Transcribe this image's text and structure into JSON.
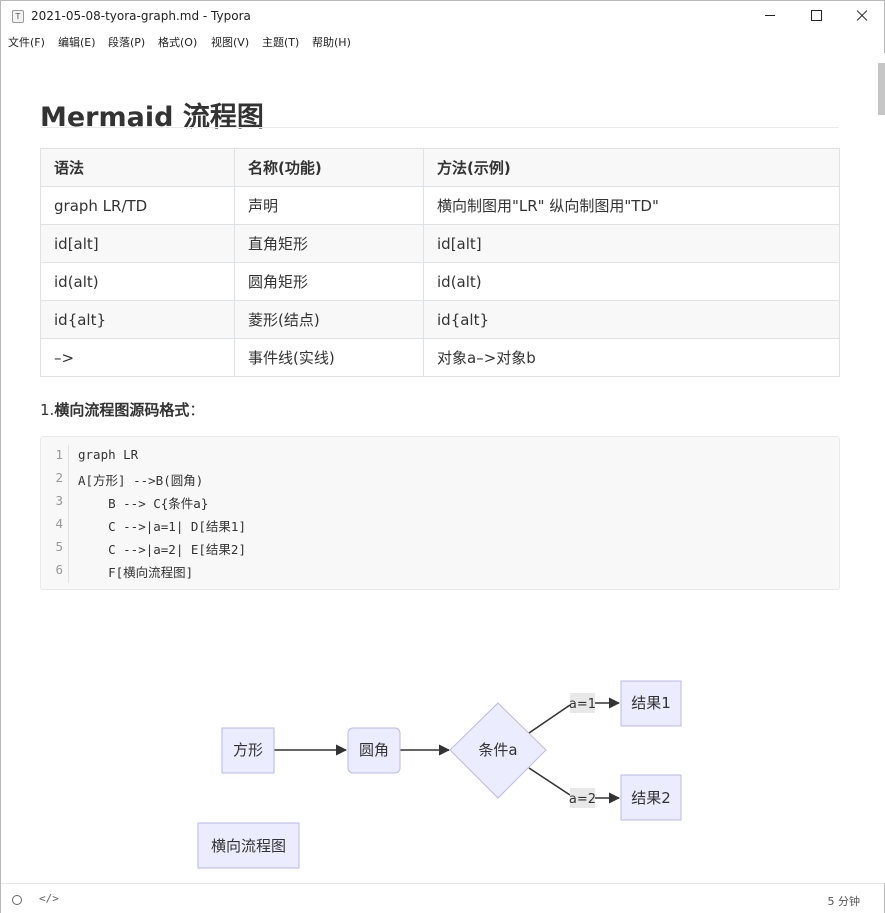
{
  "window": {
    "title": "2021-05-08-tyora-graph.md - Typora",
    "app_icon_letter": "T"
  },
  "menu": [
    "文件(F)",
    "编辑(E)",
    "段落(P)",
    "格式(O)",
    "视图(V)",
    "主题(T)",
    "帮助(H)"
  ],
  "document": {
    "heading": "Mermaid 流程图",
    "table": {
      "headers": [
        "语法",
        "名称(功能)",
        "方法(示例)"
      ],
      "rows": [
        [
          "graph LR/TD",
          "声明",
          "横向制图用\"LR\" 纵向制图用\"TD\""
        ],
        [
          "id[alt]",
          "直角矩形",
          "id[alt]"
        ],
        [
          "id(alt)",
          "圆角矩形",
          "id(alt)"
        ],
        [
          "id{alt}",
          "菱形(结点)",
          "id{alt}"
        ],
        [
          "–>",
          "事件线(实线)",
          "对象a–>对象b"
        ]
      ]
    },
    "paragraph": {
      "prefix": "1.",
      "bold": "横向流程图源码格式",
      "suffix": "："
    },
    "code": {
      "line_numbers": [
        "1",
        "2",
        "3",
        "4",
        "5",
        "6"
      ],
      "lines": [
        "graph LR",
        "A[方形] -->B(圆角)",
        "    B --> C{条件a}",
        "    C -->|a=1| D[结果1]",
        "    C -->|a=2| E[结果2]",
        "    F[横向流程图]"
      ]
    },
    "diagram": {
      "nodes": {
        "A": "方形",
        "B": "圆角",
        "C": "条件a",
        "D": "结果1",
        "E": "结果2",
        "F": "横向流程图"
      },
      "edge_labels": [
        "a=1",
        "a=2"
      ],
      "colors": {
        "node_fill": "#ececff",
        "node_stroke": "#9370db",
        "edge": "#333333",
        "label_bg": "#e8e8e8"
      }
    }
  },
  "status": {
    "word_count": "5 分钟",
    "source_icon": "</>"
  }
}
